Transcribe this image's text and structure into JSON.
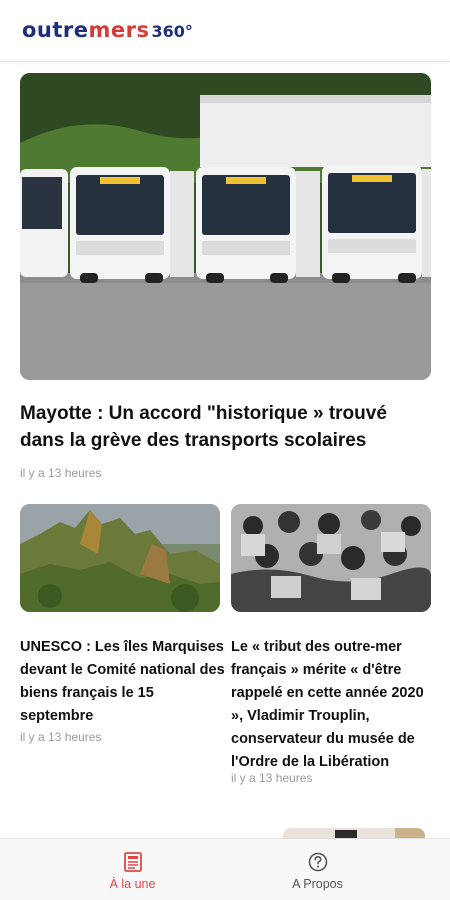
{
  "header": {
    "logo_part1": "outre",
    "logo_part2": "mers",
    "logo_part3": "360°"
  },
  "hero": {
    "title": "Mayotte : Un accord \"historique » trouvé dans la grève des transports scolaires",
    "time": "il y a 13 heures",
    "image_alt": "Row of white buses parked in a lot"
  },
  "cards": [
    {
      "title": "UNESCO : Les îles Marquises devant le Comité national des biens français le 15 septembre",
      "time": "il y a 13 heures",
      "image_alt": "Rocky green mountain peaks"
    },
    {
      "title": "Le « tribut des outre-mer français » mérite « d'être rappelé en cette année 2020 », Vladimir Trouplin, conservateur du musée de l'Ordre de la Libération",
      "time": "il y a 13 heures",
      "image_alt": "Black and white photo of soldiers"
    }
  ],
  "bottom_nav": [
    {
      "label": "À la une",
      "icon": "newspaper-icon",
      "active": true
    },
    {
      "label": "A Propos",
      "icon": "help-circle-icon",
      "active": false
    }
  ],
  "colors": {
    "brand_blue": "#1f2f7a",
    "brand_red": "#d73a3a",
    "active_tab": "#e04848"
  }
}
